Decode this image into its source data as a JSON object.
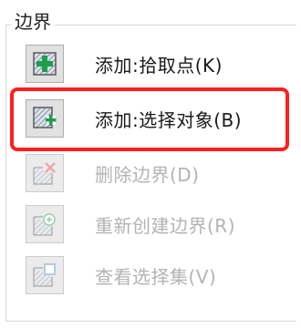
{
  "group": {
    "title": "边界"
  },
  "buttons": [
    {
      "label": "添加:拾取点(K)",
      "icon": "add-pick-point-icon",
      "enabled": true
    },
    {
      "label": "添加:选择对象(B)",
      "icon": "add-select-object-icon",
      "enabled": true,
      "highlighted": true
    },
    {
      "label": "删除边界(D)",
      "icon": "delete-boundary-icon",
      "enabled": false
    },
    {
      "label": "重新创建边界(R)",
      "icon": "recreate-boundary-icon",
      "enabled": false
    },
    {
      "label": "查看选择集(V)",
      "icon": "view-selection-set-icon",
      "enabled": false
    }
  ],
  "colors": {
    "highlight": "#ff1e1e",
    "plus_green": "#1e9e4a",
    "delete_red": "#e05a5a",
    "hatch_blue": "#5b7fb8"
  }
}
